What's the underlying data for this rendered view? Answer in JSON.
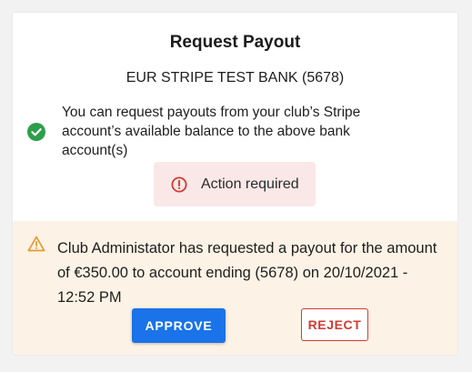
{
  "dialog": {
    "title": "Request Payout",
    "bank_account": "EUR STRIPE TEST BANK (5678)",
    "info_text": "You can request payouts from your club’s Stripe account’s available balance to the above bank account(s)",
    "action_label": "Action required"
  },
  "request": {
    "text": "Club Administator has requested a payout for the amount of €350.00 to account ending (5678) on 20/10/2021 - 12:52 PM",
    "approve_label": "APPROVE",
    "reject_label": "REJECT"
  },
  "icons": {
    "info": "check-circle-icon",
    "action": "alert-circle-icon",
    "request": "warning-triangle-icon"
  },
  "colors": {
    "primary": "#1a73e8",
    "success": "#2e9e4a",
    "danger": "#d33a32",
    "warning": "#e69a2e",
    "warning_bg": "#fcf2e5",
    "danger_bg": "#fae8e8"
  }
}
